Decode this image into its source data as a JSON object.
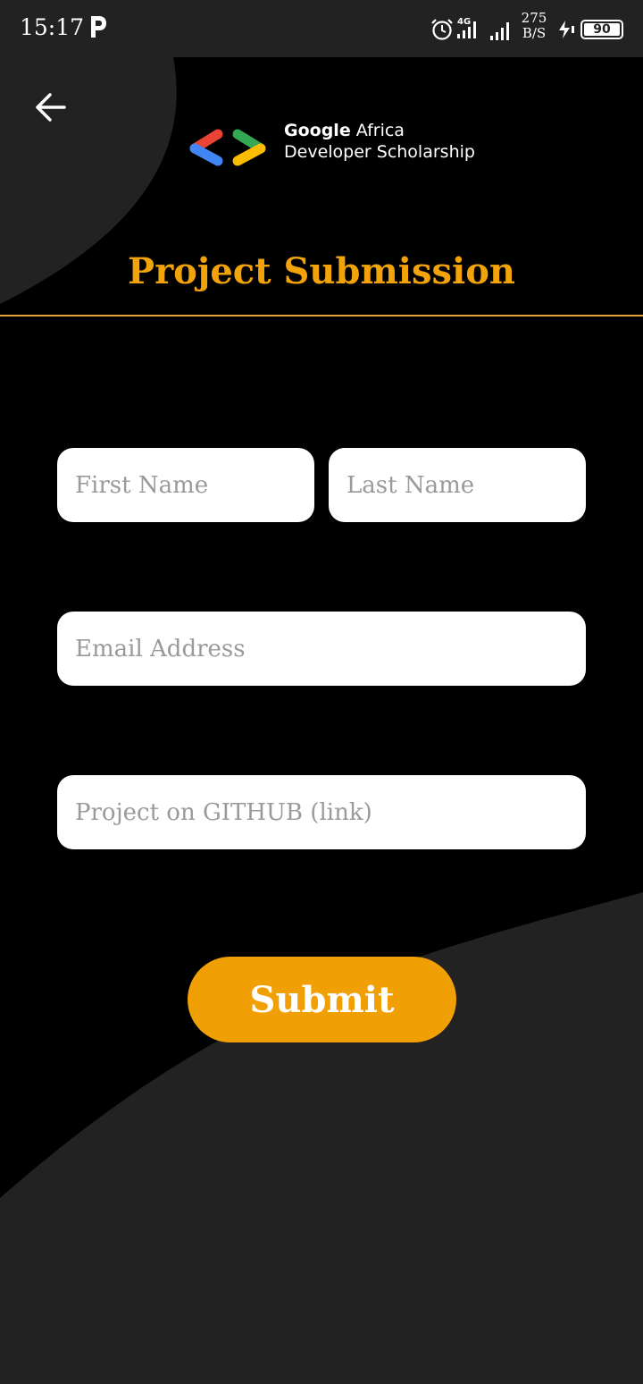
{
  "status_bar": {
    "time": "15:17",
    "network_type": "4G",
    "speed_value": "275",
    "speed_unit": "B/S",
    "battery": "90"
  },
  "header": {
    "logo_line1_bold": "Google",
    "logo_line1_rest": " Africa",
    "logo_line2": "Developer Scholarship",
    "title": "Project Submission"
  },
  "form": {
    "first_name_placeholder": "First Name",
    "last_name_placeholder": "Last Name",
    "email_placeholder": "Email Address",
    "github_placeholder": "Project on GITHUB (link)",
    "submit_label": "Submit"
  },
  "colors": {
    "accent": "#F0A004",
    "background": "#000000",
    "surface": "#222222",
    "logo_red": "#EA4335",
    "logo_blue": "#4285F4",
    "logo_green": "#34A853",
    "logo_yellow": "#FBBC04"
  }
}
